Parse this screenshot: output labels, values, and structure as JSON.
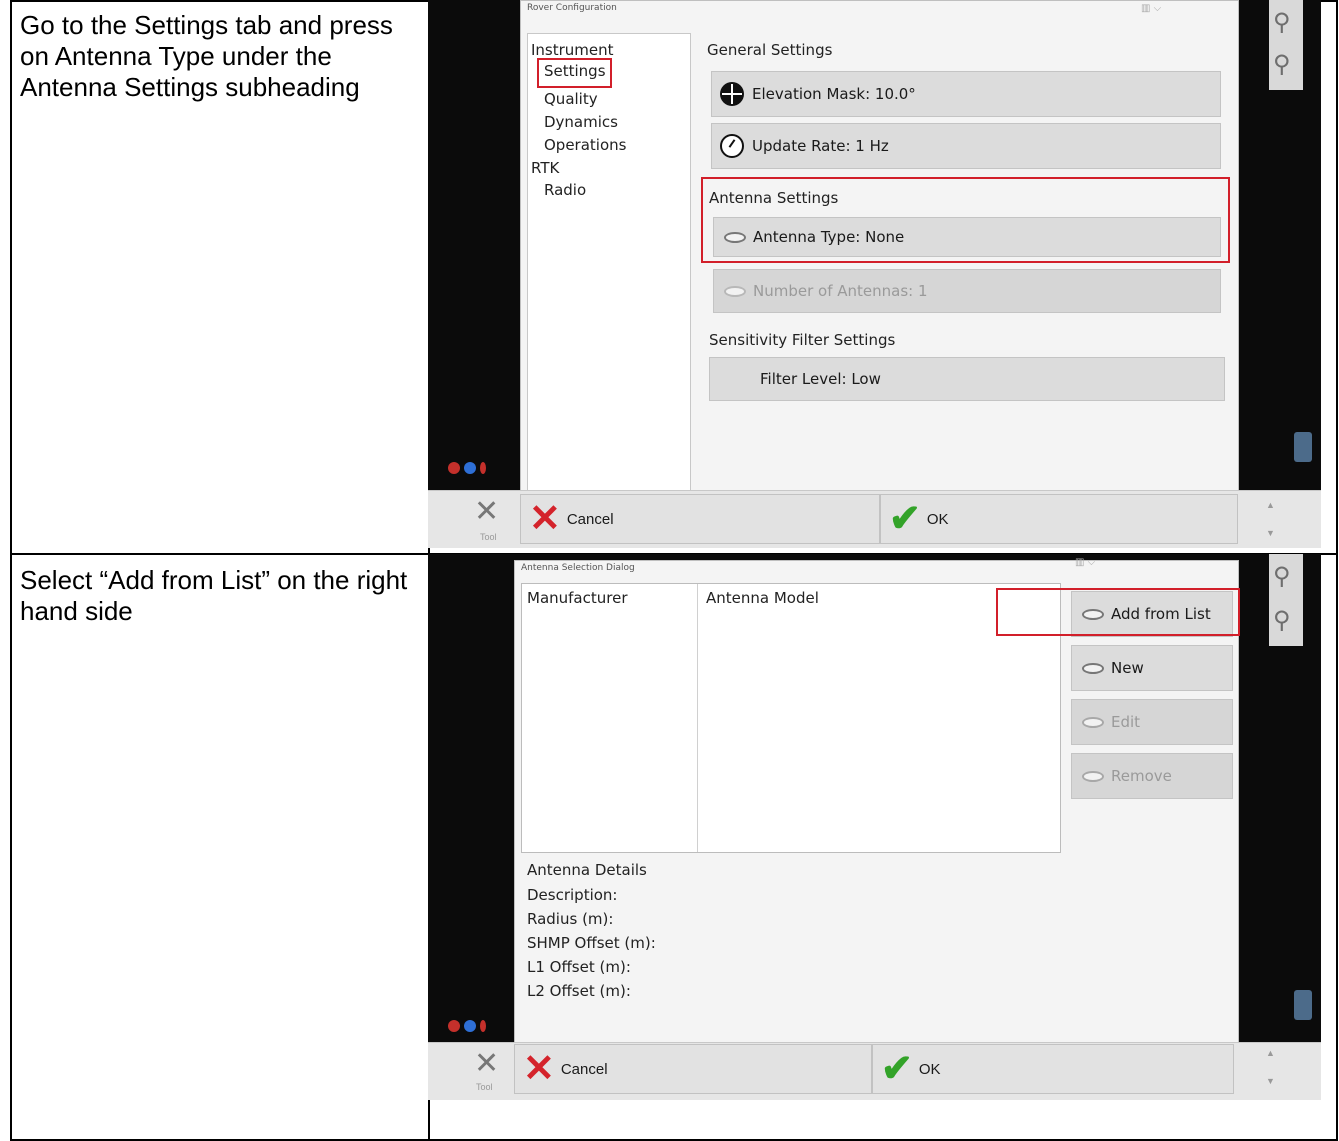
{
  "steps": [
    {
      "instruction": "Go to the Settings tab and press on Antenna Type under the Antenna Settings subheading",
      "dialog": {
        "title": "Rover Configuration",
        "tree": [
          "Instrument",
          "Settings",
          "Quality",
          "Dynamics",
          "Operations",
          "RTK",
          "Radio"
        ],
        "general_heading": "General Settings",
        "elevation_mask": "Elevation Mask: 10.0°",
        "update_rate": "Update Rate: 1 Hz",
        "antenna_heading": "Antenna Settings",
        "antenna_type": "Antenna Type: None",
        "num_antennas": "Number of Antennas: 1",
        "sensitivity_heading": "Sensitivity Filter Settings",
        "filter_level": "Filter Level: Low",
        "cancel": "Cancel",
        "ok": "OK"
      }
    },
    {
      "instruction": "Select “Add from List” on the right hand side",
      "dialog": {
        "title": "Antenna Selection Dialog",
        "col_manufacturer": "Manufacturer",
        "col_model": "Antenna Model",
        "add_from_list": "Add from List",
        "new": "New",
        "edit": "Edit",
        "remove": "Remove",
        "details_heading": "Antenna Details",
        "description": "Description:",
        "radius": "Radius (m):",
        "shmp_offset": "SHMP Offset (m):",
        "l1_offset": "L1 Offset (m):",
        "l2_offset": "L2 Offset (m):",
        "cancel": "Cancel",
        "ok": "OK"
      }
    }
  ],
  "icons": {
    "magnifier": "magnifier-icon",
    "cancel": "red-x-icon",
    "ok": "green-check-icon",
    "antenna": "antenna-icon",
    "globe": "globe-icon",
    "clock": "clock-icon",
    "tools": "tools-icon"
  },
  "colors": {
    "highlight": "#d21f2a",
    "cancel": "#d4232b",
    "ok": "#33a329"
  }
}
